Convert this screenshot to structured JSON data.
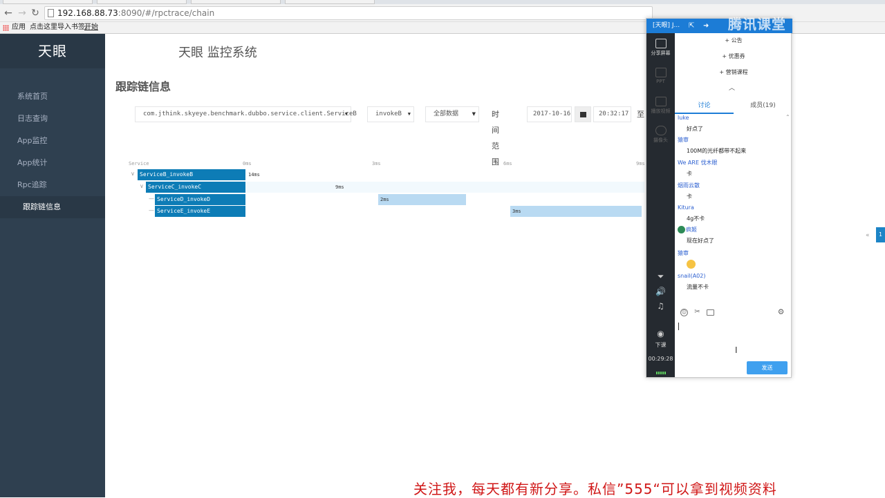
{
  "browser": {
    "url_host": "192.168.88.73",
    "url_path": ":8090/#/rpctrace/chain",
    "bookmarks_apps": "应用",
    "bookmarks_hint": "点击这里导入书签。",
    "bookmarks_start": "开始"
  },
  "sidebar": {
    "brand": "天眼",
    "items": [
      {
        "label": "系统首页"
      },
      {
        "label": "日志查询"
      },
      {
        "label": "App监控"
      },
      {
        "label": "App统计"
      },
      {
        "label": "Rpc追踪"
      },
      {
        "label": "跟踪链信息"
      }
    ]
  },
  "header": {
    "system_title": "天眼 监控系统",
    "page_title": "跟踪链信息"
  },
  "filters": {
    "service": "com.jthink.skyeye.benchmark.dubbo.service.client.ServiceB",
    "method": "invokeB",
    "data_scope": "全部数据",
    "time_range_label": "时间范围",
    "date": "2017-10-16",
    "time": "20:32:17",
    "to_label": "至"
  },
  "trace": {
    "axis": {
      "label": "Service",
      "ticks": [
        "0ms",
        "3ms",
        "6ms",
        "9ms"
      ]
    },
    "spans": [
      {
        "name": "ServiceB_invokeB",
        "duration": "14ms",
        "level": 0
      },
      {
        "name": "ServiceC_invokeC",
        "duration": "9ms",
        "level": 1
      },
      {
        "name": "ServiceD_invokeD",
        "duration": "2ms",
        "level": 2
      },
      {
        "name": "ServiceE_invokeE",
        "duration": "3ms",
        "level": 2
      }
    ]
  },
  "pager": {
    "prev": "«",
    "current": "1"
  },
  "classroom": {
    "title": "[天眼] J...",
    "watermark": "腾讯课堂",
    "left_tools": [
      {
        "label": "分享屏幕"
      },
      {
        "label": "PPT"
      },
      {
        "label": "播放视频"
      },
      {
        "label": "摄像头"
      }
    ],
    "end_class_label": "下课",
    "timer": "00:29:28",
    "menu": [
      "+ 公告",
      "+ 优惠券",
      "+ 营销课程"
    ],
    "tabs": [
      "讨论",
      "成员(19)"
    ],
    "messages": [
      {
        "user": "luke",
        "text": "好点了"
      },
      {
        "user": "猿审",
        "text": "100M的光纤都带不起来"
      },
      {
        "user": "We ARE 伐木眼",
        "text": "卡"
      },
      {
        "user": "烟雨云散",
        "text": "卡"
      },
      {
        "user": "Kitura",
        "text": "4g不卡"
      },
      {
        "user": "疯姬",
        "text": "现在好点了"
      },
      {
        "user": "猿审",
        "text": ""
      },
      {
        "user": "snail(A02)",
        "text": "流量不卡"
      }
    ],
    "send_label": "发送"
  },
  "caption": "关注我，每天都有新分享。私信”555“可以拿到视频资料"
}
